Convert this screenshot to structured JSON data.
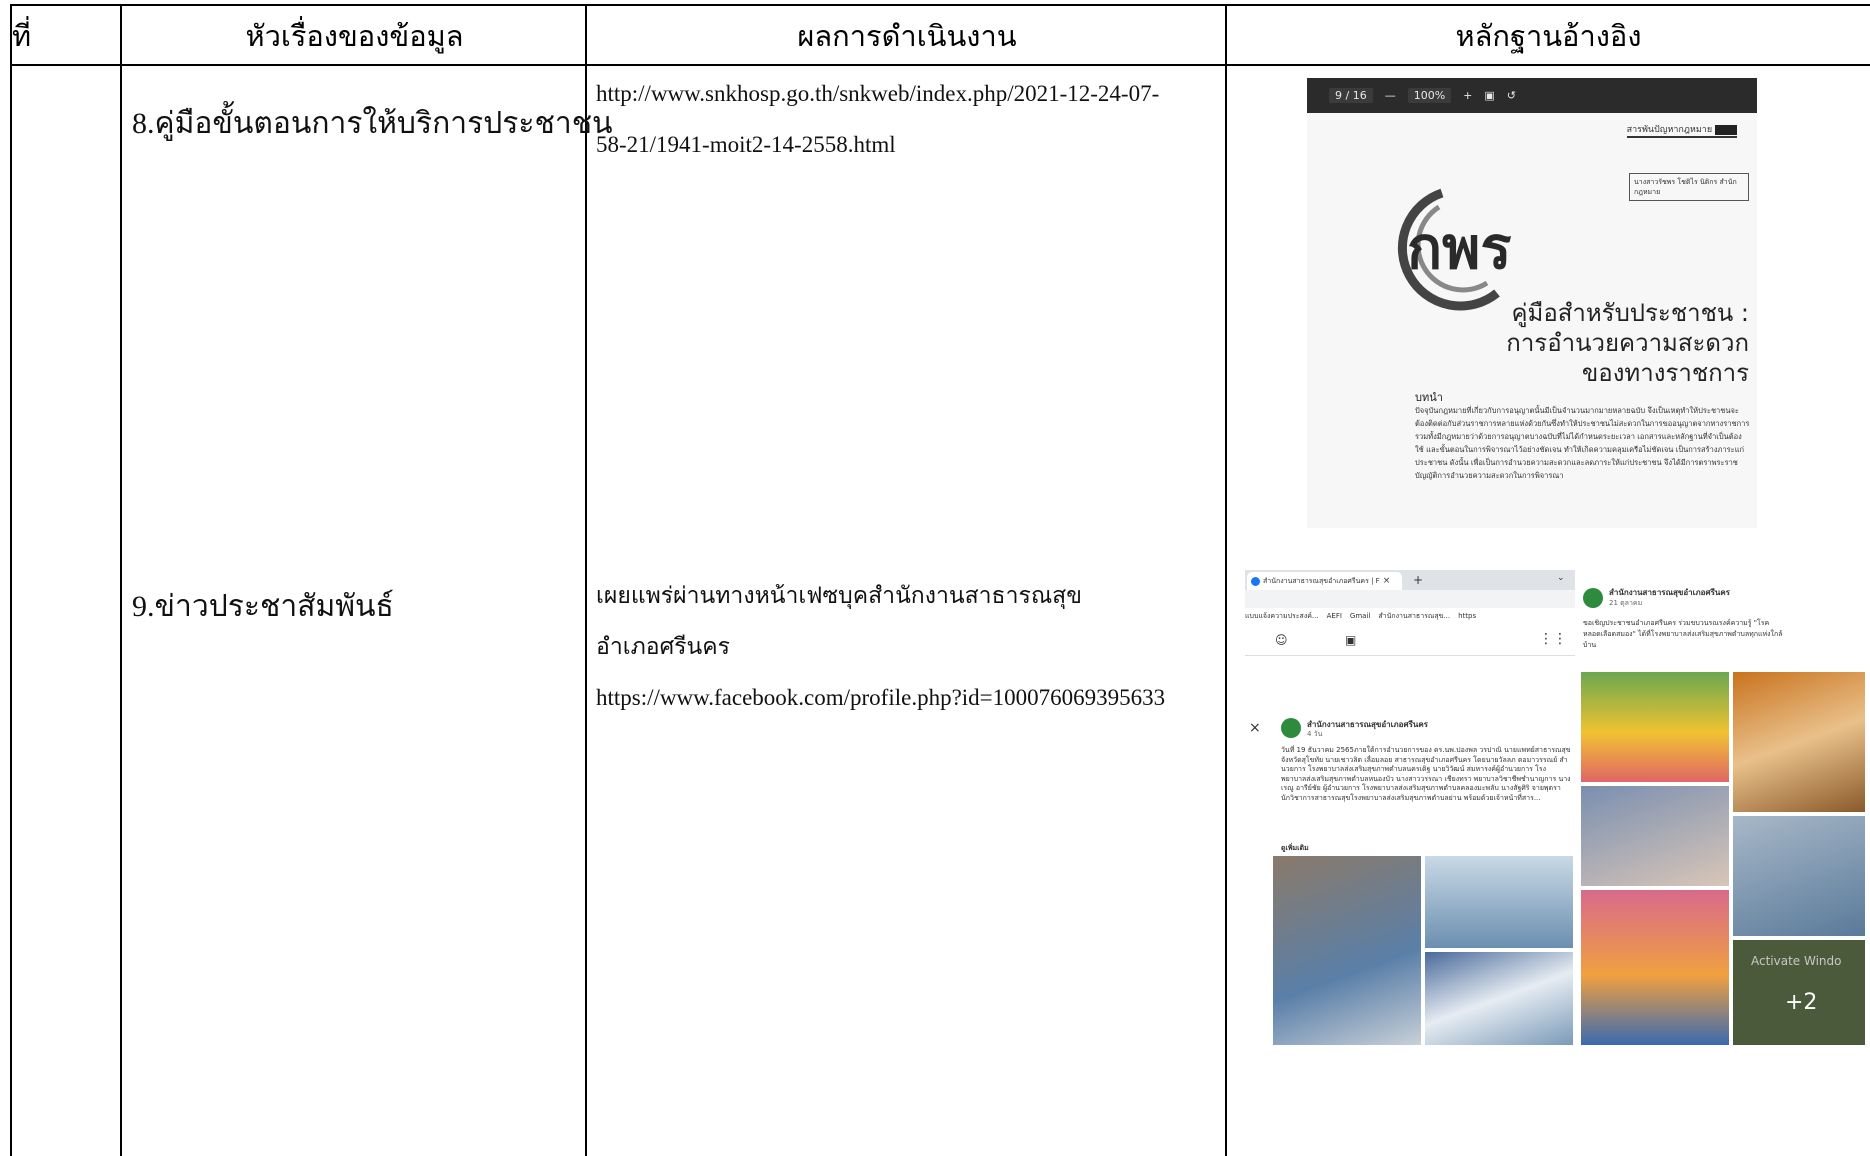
{
  "table": {
    "headers": {
      "no": "ที่",
      "topic": "หัวเรื่องของข้อมูล",
      "result": "ผลการดำเนินงาน",
      "evidence": "หลักฐานอ้างอิง"
    },
    "rows": [
      {
        "topic": "8.คู่มือขั้นตอนการให้บริการประชาชน",
        "result_line1": "http://www.snkhosp.go.th/snkweb/index.php/2021-12-24-07-",
        "result_line2": "58-21/1941-moit2-14-2558.html"
      },
      {
        "topic": "9.ข่าวประชาสัมพันธ์",
        "result_line1": "เผยแพร่ผ่านทางหน้าเฟซบุคสำนักงานสาธารณสุข",
        "result_line2": "อำเภอศรีนคร",
        "result_line3": "https://www.facebook.com/profile.php?id=100076069395633"
      }
    ]
  },
  "evidence_pdf": {
    "page_indicator": "9 / 16",
    "zoom": "100%",
    "logo_text": "กพร",
    "header_right": "สารพันปัญหากฎหมาย",
    "author_box": "นางสาวรัชพร โชติไร นิติกร สำนักกฎหมาย",
    "title_line1": "คู่มือสำหรับประชาชน :",
    "title_line2": "การอำนวยความสะดวก",
    "title_line3": "ของทางราชการ",
    "intro_heading": "บทนำ",
    "intro_text": "ปัจจุบันกฎหมายที่เกี่ยวกับการอนุญาตนั้นมีเป็นจำนวนมากมายหลายฉบับ จึงเป็นเหตุทำให้ประชาชนจะต้องติดต่อกับส่วนราชการหลายแห่งด้วยกันซึ่งทำให้ประชาชนไม่สะดวกในการขออนุญาตจากทางราชการ รวมทั้งมีกฎหมายว่าด้วยการอนุญาตบางฉบับที่ไม่ได้กำหนดระยะเวลา เอกสารและหลักฐานที่จำเป็นต้องใช้ และขั้นตอนในการพิจารณาไว้อย่างชัดเจน ทำให้เกิดความคลุมเครือไม่ชัดเจน เป็นการสร้างภาระแก่ประชาชน ดังนั้น เพื่อเป็นการอำนวยความสะดวกและลดภาระให้แก่ประชาชน จึงได้มีการตราพระราชบัญญัติการอำนวยความสะดวกในการพิจารณา"
  },
  "evidence_fb": {
    "tab_title": "สำนักงานสาธารณสุขอำเภอศรีนคร | F",
    "bookmarks": [
      "แบบแจ้งความประสงค์...",
      "AEFI",
      "Gmail",
      "สำนักงานสาธารณสุข...",
      "https"
    ],
    "page_name": "สำนักงานสาธารณสุขอำเภอศรีนคร",
    "post1_time": "4 วัน",
    "post1_text": "วันที่ 19 ธันวาคม 2565ภายใต้การอำนวยการของ ดร.นพ.ปองพล วรปาณิ นายแพทย์สาธารณสุขจังหวัดสุโขทัย นายเชาวลิต เลื่อมลอย สาธารณสุขอำเภอศรีนคร โดยนายวัลลภ ตอมาวรรณย์ สำนวยการ โรงพยาบาลส่งเสริมสุขภาพตำบลนครเดิฐ นายวิวัฒน์ สมหารงค์ผู้อำนวยการ โรงพยาบาลส่งเสริมสุขภาพตำบลหนองบัว นางสาววรรณา เชียงทรา พยาบาลวิชาชีพชำนาญการ นางเรณู อารีย์ชัย ผู้อำนวยการ โรงพยาบาลส่งเสริมสุขภาพตำบลคลองมะพลับ นางสัฐศิริ จายพุตรา นักวิชาการสาธารณสุขโรงพยาบาลส่งเสริมสุขภาพตำบลย่าน พร้อมด้วยเจ้าหน้าที่สาร...",
    "see_more": "ดูเพิ่มเติม",
    "post2_time": "21 ตุลาคม",
    "post2_text": "ขอเชิญประชาชนอำเภอศรีนคร ร่วมขบวนรณรงค์ความรู้ \"โรคหลอดเลือดสมอง\" ได้ที่โรงพยาบาลส่งเสริมสุขภาพตำบลทุกแห่งใกล้บ้าน",
    "more_count": "+2",
    "watermark": "Activate Windo"
  }
}
